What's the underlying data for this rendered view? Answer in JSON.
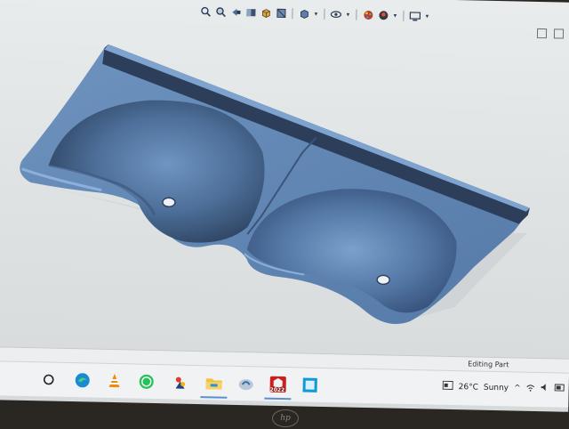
{
  "statusbar": {
    "text": "Editing Part"
  },
  "heads_up_toolbar": {
    "icons": [
      "zoom-to-fit-icon",
      "zoom-area-icon",
      "previous-view-icon",
      "section-view-icon",
      "view-orientation-icon",
      "display-style-icon",
      "hide-show-icon",
      "edit-appearance-icon",
      "apply-scene-icon",
      "view-settings-icon"
    ]
  },
  "taskbar": {
    "apps": [
      "search",
      "edge",
      "vlc",
      "whatsapp",
      "solidworks-explorer",
      "file-explorer",
      "apps",
      "solidworks-2022",
      "screen"
    ],
    "solidworks_badge": "2022",
    "weather": {
      "temperature": "26°C",
      "condition": "Sunny"
    }
  },
  "bezel": {
    "logo": "hp"
  },
  "colors": {
    "model_blue": "#5b7fa8",
    "taskbar_bg": "#f1f2f3"
  }
}
